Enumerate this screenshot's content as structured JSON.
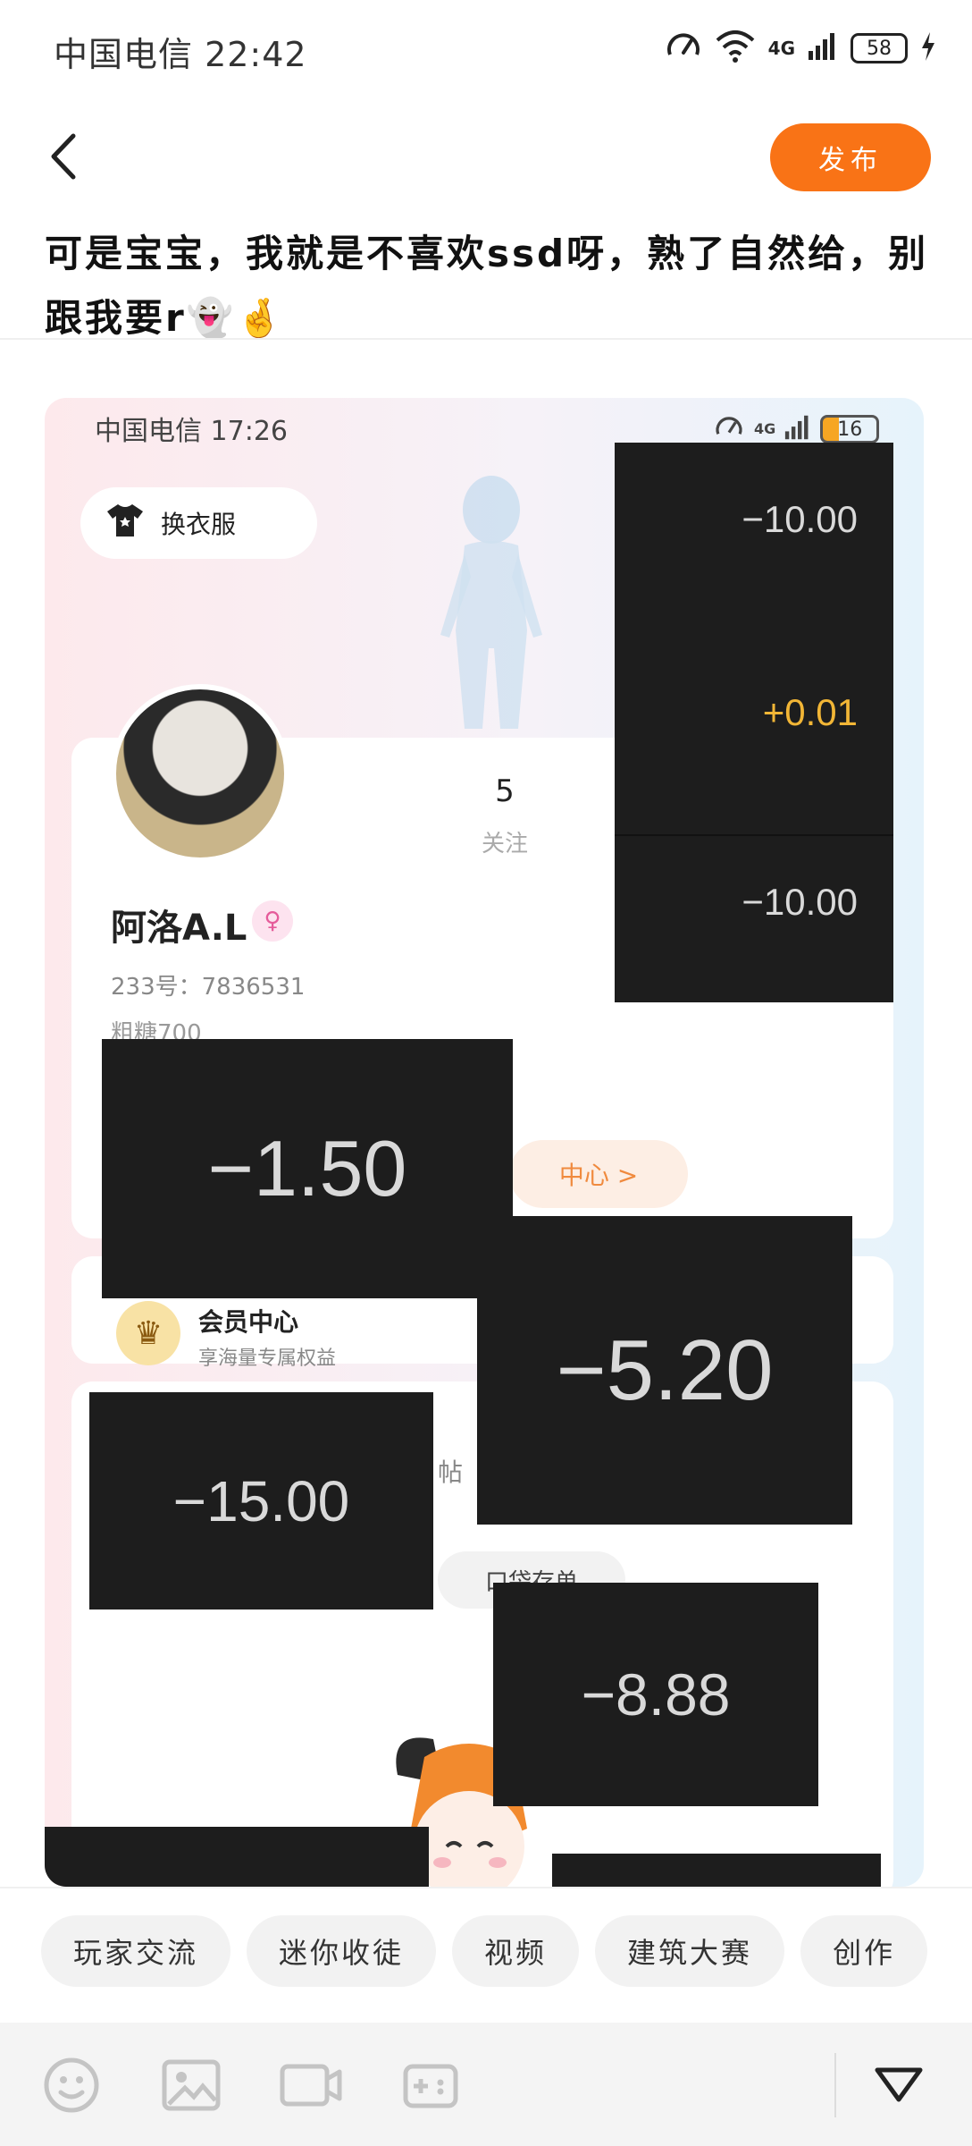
{
  "status_bar": {
    "carrier": "中国电信 22:42",
    "network": "4G",
    "battery": "58"
  },
  "header": {
    "back_icon": "chevron-left-icon",
    "publish_label": "发布",
    "accent_color": "#f97316"
  },
  "post": {
    "text": "可是宝宝，我就是不喜欢ssd呀，熟了自然给，别跟我要r👻🤞"
  },
  "attached_image": {
    "status_carrier": "中国电信 17:26",
    "status_network": "4G",
    "status_battery": "16",
    "dress_button": "换衣服",
    "follow_count": "5",
    "follow_label": "关注",
    "username": "阿洛A.L",
    "gender_icon": "female-icon",
    "user_id": "233号：7836531",
    "faded_text": "粗糖700",
    "center_pill": "中心 >",
    "vip_title": "会员中心",
    "vip_subtitle": "享海量专属权益",
    "partial_tab": "帖",
    "partial_button": "口袋存单",
    "amounts": {
      "top_1": "−10.00",
      "top_2": "+0.01",
      "top_3": "−10.00",
      "box_a": "−1.50",
      "box_b": "−5.20",
      "box_c": "−15.00",
      "box_d": "−8.88"
    }
  },
  "tags": [
    "玩家交流",
    "迷你收徒",
    "视频",
    "建筑大赛",
    "创作"
  ],
  "toolbar": {
    "icons": [
      "emoji-icon",
      "image-icon",
      "video-icon",
      "game-icon",
      "collapse-icon"
    ]
  }
}
